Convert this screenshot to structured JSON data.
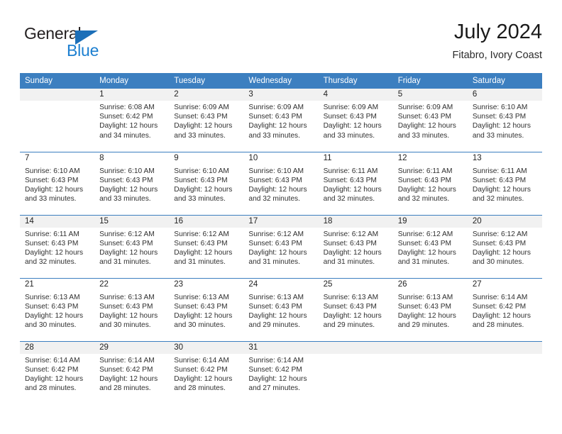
{
  "brand": {
    "name_top": "General",
    "name_bottom": "Blue",
    "triangle_color": "#1c6fb8",
    "blue_color": "#1c7fd0",
    "dark_color": "#231f20",
    "logo_icon": "triangle-icon"
  },
  "header": {
    "title": "July 2024",
    "subtitle": "Fitabro, Ivory Coast"
  },
  "theme": {
    "header_bg": "#3c7fc0",
    "header_text": "#ffffff",
    "band_shaded": "#f1f1f1",
    "row_divider": "#3c7fc0",
    "body_text": "#303030"
  },
  "weekdays": [
    "Sunday",
    "Monday",
    "Tuesday",
    "Wednesday",
    "Thursday",
    "Friday",
    "Saturday"
  ],
  "weeks": [
    [
      {
        "day": "",
        "sunrise": "",
        "sunset": "",
        "daylight_line1": "",
        "daylight_line2": ""
      },
      {
        "day": "1",
        "sunrise": "Sunrise: 6:08 AM",
        "sunset": "Sunset: 6:42 PM",
        "daylight_line1": "Daylight: 12 hours",
        "daylight_line2": "and 34 minutes."
      },
      {
        "day": "2",
        "sunrise": "Sunrise: 6:09 AM",
        "sunset": "Sunset: 6:43 PM",
        "daylight_line1": "Daylight: 12 hours",
        "daylight_line2": "and 33 minutes."
      },
      {
        "day": "3",
        "sunrise": "Sunrise: 6:09 AM",
        "sunset": "Sunset: 6:43 PM",
        "daylight_line1": "Daylight: 12 hours",
        "daylight_line2": "and 33 minutes."
      },
      {
        "day": "4",
        "sunrise": "Sunrise: 6:09 AM",
        "sunset": "Sunset: 6:43 PM",
        "daylight_line1": "Daylight: 12 hours",
        "daylight_line2": "and 33 minutes."
      },
      {
        "day": "5",
        "sunrise": "Sunrise: 6:09 AM",
        "sunset": "Sunset: 6:43 PM",
        "daylight_line1": "Daylight: 12 hours",
        "daylight_line2": "and 33 minutes."
      },
      {
        "day": "6",
        "sunrise": "Sunrise: 6:10 AM",
        "sunset": "Sunset: 6:43 PM",
        "daylight_line1": "Daylight: 12 hours",
        "daylight_line2": "and 33 minutes."
      }
    ],
    [
      {
        "day": "7",
        "sunrise": "Sunrise: 6:10 AM",
        "sunset": "Sunset: 6:43 PM",
        "daylight_line1": "Daylight: 12 hours",
        "daylight_line2": "and 33 minutes."
      },
      {
        "day": "8",
        "sunrise": "Sunrise: 6:10 AM",
        "sunset": "Sunset: 6:43 PM",
        "daylight_line1": "Daylight: 12 hours",
        "daylight_line2": "and 33 minutes."
      },
      {
        "day": "9",
        "sunrise": "Sunrise: 6:10 AM",
        "sunset": "Sunset: 6:43 PM",
        "daylight_line1": "Daylight: 12 hours",
        "daylight_line2": "and 33 minutes."
      },
      {
        "day": "10",
        "sunrise": "Sunrise: 6:10 AM",
        "sunset": "Sunset: 6:43 PM",
        "daylight_line1": "Daylight: 12 hours",
        "daylight_line2": "and 32 minutes."
      },
      {
        "day": "11",
        "sunrise": "Sunrise: 6:11 AM",
        "sunset": "Sunset: 6:43 PM",
        "daylight_line1": "Daylight: 12 hours",
        "daylight_line2": "and 32 minutes."
      },
      {
        "day": "12",
        "sunrise": "Sunrise: 6:11 AM",
        "sunset": "Sunset: 6:43 PM",
        "daylight_line1": "Daylight: 12 hours",
        "daylight_line2": "and 32 minutes."
      },
      {
        "day": "13",
        "sunrise": "Sunrise: 6:11 AM",
        "sunset": "Sunset: 6:43 PM",
        "daylight_line1": "Daylight: 12 hours",
        "daylight_line2": "and 32 minutes."
      }
    ],
    [
      {
        "day": "14",
        "sunrise": "Sunrise: 6:11 AM",
        "sunset": "Sunset: 6:43 PM",
        "daylight_line1": "Daylight: 12 hours",
        "daylight_line2": "and 32 minutes."
      },
      {
        "day": "15",
        "sunrise": "Sunrise: 6:12 AM",
        "sunset": "Sunset: 6:43 PM",
        "daylight_line1": "Daylight: 12 hours",
        "daylight_line2": "and 31 minutes."
      },
      {
        "day": "16",
        "sunrise": "Sunrise: 6:12 AM",
        "sunset": "Sunset: 6:43 PM",
        "daylight_line1": "Daylight: 12 hours",
        "daylight_line2": "and 31 minutes."
      },
      {
        "day": "17",
        "sunrise": "Sunrise: 6:12 AM",
        "sunset": "Sunset: 6:43 PM",
        "daylight_line1": "Daylight: 12 hours",
        "daylight_line2": "and 31 minutes."
      },
      {
        "day": "18",
        "sunrise": "Sunrise: 6:12 AM",
        "sunset": "Sunset: 6:43 PM",
        "daylight_line1": "Daylight: 12 hours",
        "daylight_line2": "and 31 minutes."
      },
      {
        "day": "19",
        "sunrise": "Sunrise: 6:12 AM",
        "sunset": "Sunset: 6:43 PM",
        "daylight_line1": "Daylight: 12 hours",
        "daylight_line2": "and 31 minutes."
      },
      {
        "day": "20",
        "sunrise": "Sunrise: 6:12 AM",
        "sunset": "Sunset: 6:43 PM",
        "daylight_line1": "Daylight: 12 hours",
        "daylight_line2": "and 30 minutes."
      }
    ],
    [
      {
        "day": "21",
        "sunrise": "Sunrise: 6:13 AM",
        "sunset": "Sunset: 6:43 PM",
        "daylight_line1": "Daylight: 12 hours",
        "daylight_line2": "and 30 minutes."
      },
      {
        "day": "22",
        "sunrise": "Sunrise: 6:13 AM",
        "sunset": "Sunset: 6:43 PM",
        "daylight_line1": "Daylight: 12 hours",
        "daylight_line2": "and 30 minutes."
      },
      {
        "day": "23",
        "sunrise": "Sunrise: 6:13 AM",
        "sunset": "Sunset: 6:43 PM",
        "daylight_line1": "Daylight: 12 hours",
        "daylight_line2": "and 30 minutes."
      },
      {
        "day": "24",
        "sunrise": "Sunrise: 6:13 AM",
        "sunset": "Sunset: 6:43 PM",
        "daylight_line1": "Daylight: 12 hours",
        "daylight_line2": "and 29 minutes."
      },
      {
        "day": "25",
        "sunrise": "Sunrise: 6:13 AM",
        "sunset": "Sunset: 6:43 PM",
        "daylight_line1": "Daylight: 12 hours",
        "daylight_line2": "and 29 minutes."
      },
      {
        "day": "26",
        "sunrise": "Sunrise: 6:13 AM",
        "sunset": "Sunset: 6:43 PM",
        "daylight_line1": "Daylight: 12 hours",
        "daylight_line2": "and 29 minutes."
      },
      {
        "day": "27",
        "sunrise": "Sunrise: 6:14 AM",
        "sunset": "Sunset: 6:42 PM",
        "daylight_line1": "Daylight: 12 hours",
        "daylight_line2": "and 28 minutes."
      }
    ],
    [
      {
        "day": "28",
        "sunrise": "Sunrise: 6:14 AM",
        "sunset": "Sunset: 6:42 PM",
        "daylight_line1": "Daylight: 12 hours",
        "daylight_line2": "and 28 minutes."
      },
      {
        "day": "29",
        "sunrise": "Sunrise: 6:14 AM",
        "sunset": "Sunset: 6:42 PM",
        "daylight_line1": "Daylight: 12 hours",
        "daylight_line2": "and 28 minutes."
      },
      {
        "day": "30",
        "sunrise": "Sunrise: 6:14 AM",
        "sunset": "Sunset: 6:42 PM",
        "daylight_line1": "Daylight: 12 hours",
        "daylight_line2": "and 28 minutes."
      },
      {
        "day": "31",
        "sunrise": "Sunrise: 6:14 AM",
        "sunset": "Sunset: 6:42 PM",
        "daylight_line1": "Daylight: 12 hours",
        "daylight_line2": "and 27 minutes."
      },
      {
        "day": "",
        "sunrise": "",
        "sunset": "",
        "daylight_line1": "",
        "daylight_line2": ""
      },
      {
        "day": "",
        "sunrise": "",
        "sunset": "",
        "daylight_line1": "",
        "daylight_line2": ""
      },
      {
        "day": "",
        "sunrise": "",
        "sunset": "",
        "daylight_line1": "",
        "daylight_line2": ""
      }
    ]
  ]
}
